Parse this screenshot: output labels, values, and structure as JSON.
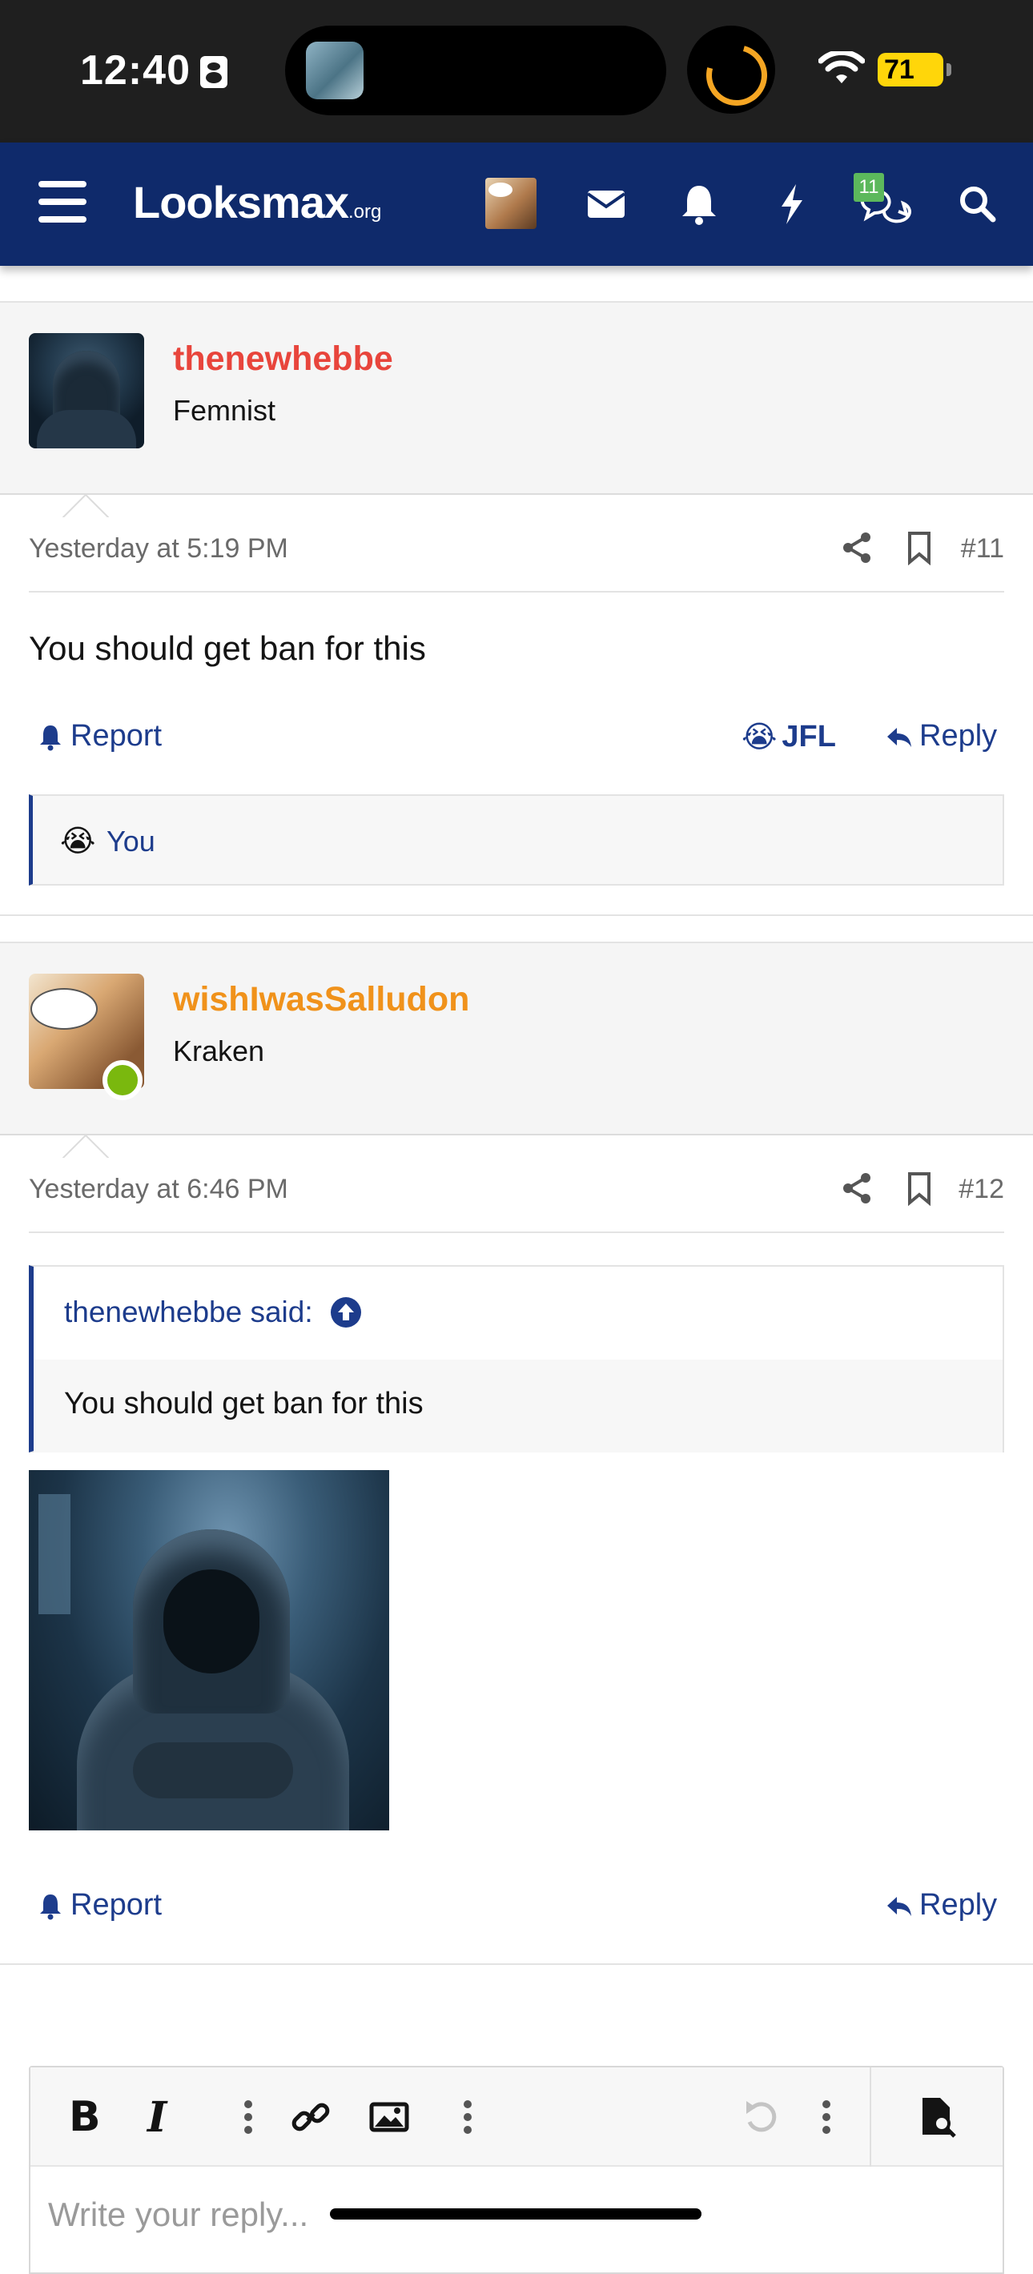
{
  "status_bar": {
    "time": "12:40",
    "battery": "71"
  },
  "nav": {
    "logo_main": "Looksmax",
    "logo_suffix": ".org",
    "conversation_badge": "11"
  },
  "posts": [
    {
      "username": "thenewhebbe",
      "username_color": "#e8453c",
      "user_title": "Femnist",
      "date": "Yesterday at 5:19 PM",
      "post_number": "#11",
      "text": "You should get ban for this",
      "report_label": "Report",
      "reaction_label": "JFL",
      "reply_label": "Reply",
      "reactions": {
        "emoji": "😭",
        "users": "You"
      }
    },
    {
      "username": "wishIwasSalludon",
      "username_color": "#f0921b",
      "user_title": "Kraken",
      "date": "Yesterday at 6:46 PM",
      "post_number": "#12",
      "quote": {
        "author_line": "thenewhebbe said:",
        "text": "You should get ban for this"
      },
      "report_label": "Report",
      "reply_label": "Reply"
    }
  ],
  "editor": {
    "placeholder": "Write your reply..."
  },
  "colors": {
    "nav_bg": "#0f2a6b",
    "link": "#1d3c8c",
    "accent_online": "#7ab80e"
  },
  "icons": [
    "menu-icon",
    "envelope-icon",
    "bell-icon",
    "bolt-icon",
    "conversations-icon",
    "search-icon",
    "share-icon",
    "bookmark-icon",
    "reply-icon",
    "arrow-up-icon",
    "bold-icon",
    "italic-icon",
    "more-icon",
    "link-icon",
    "image-icon",
    "undo-icon",
    "preview-icon"
  ]
}
